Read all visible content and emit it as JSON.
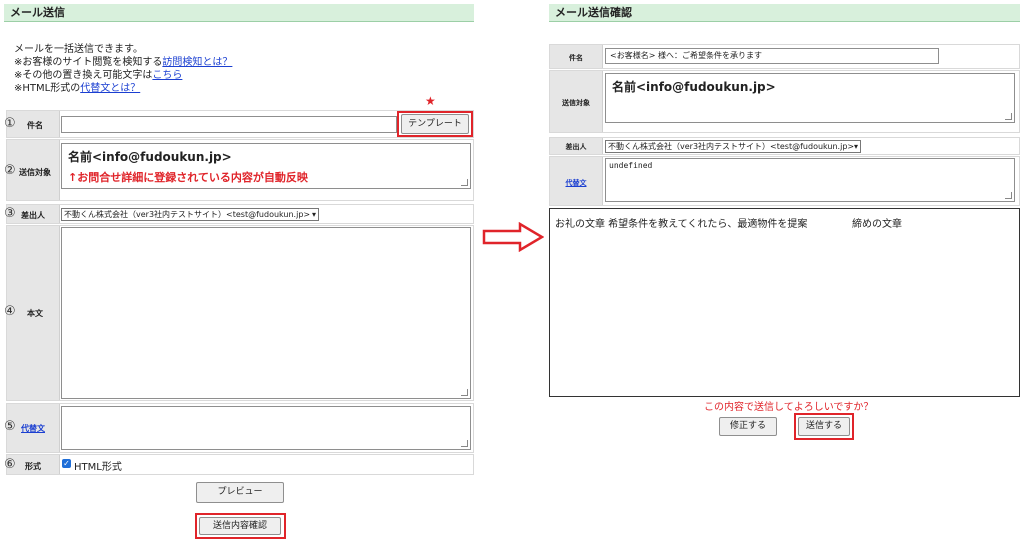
{
  "left": {
    "header": "メール送信",
    "intro": {
      "line1": "メールを一括送信できます。",
      "line2_prefix": "※お客様のサイト閲覧を検知する",
      "line2_link": "訪問検知とは？",
      "line3_prefix": "※その他の置き換え可能文字は",
      "line3_link": "こちら",
      "line4_prefix": "※HTML形式の",
      "line4_link": "代替文とは？"
    },
    "rows": {
      "subject": {
        "num": "①",
        "label": "件名",
        "value": "",
        "template_button": "テンプレート"
      },
      "recipient": {
        "num": "②",
        "label": "送信対象",
        "value": "名前<info@fudoukun.jp>",
        "note": "↑お問合せ詳細に登録されている内容が自動反映"
      },
      "sender": {
        "num": "③",
        "label": "差出人",
        "value": "不動くん株式会社（ver3社内テストサイト）<test@fudoukun.jp>"
      },
      "body": {
        "num": "④",
        "label": "本文",
        "value": ""
      },
      "alt": {
        "num": "⑤",
        "label": "代替文",
        "value": ""
      },
      "format": {
        "num": "⑥",
        "label": "形式",
        "checkbox_label": "HTML形式",
        "checked": true
      }
    },
    "star": "★",
    "preview_button": "プレビュー",
    "confirm_button": "送信内容確認"
  },
  "arrow": "⇨",
  "right": {
    "header": "メール送信確認",
    "rows": {
      "subject": {
        "label": "件名",
        "value": "<お客様名> 様へ：ご希望条件を承ります"
      },
      "recipient": {
        "label": "送信対象",
        "value": "名前<info@fudoukun.jp>"
      },
      "sender": {
        "label": "差出人",
        "value": "不動くん株式会社（ver3社内テストサイト）<test@fudoukun.jp>"
      },
      "alt": {
        "label": "代替文",
        "value": "undefined"
      }
    },
    "body_text": {
      "part1": "お礼の文章 希望条件を教えてくれたら、最適物件を提案",
      "part2": "締めの文章"
    },
    "confirm_question": "この内容で送信してよろしいですか？",
    "edit_button": "修正する",
    "send_button": "送信する"
  },
  "colors": {
    "header_bg": "#d8f0dc",
    "highlight_red": "#e0242a",
    "link_blue": "#1b3fd1"
  }
}
